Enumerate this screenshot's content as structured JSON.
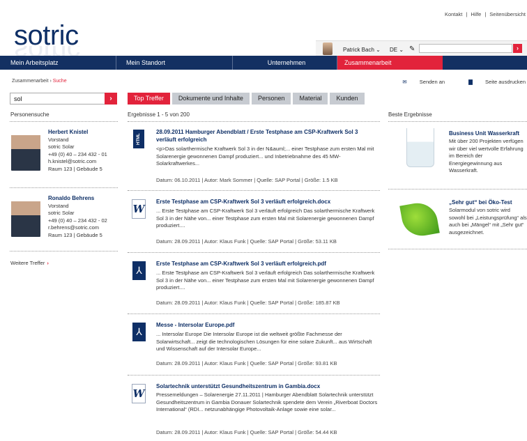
{
  "header": {
    "logo": "sotric",
    "top_links": [
      "Kontakt",
      "Hilfe",
      "Seitenübersicht"
    ],
    "user_name": "Patrick Bach ⌄",
    "language": "DE ⌄",
    "search_placeholder": ""
  },
  "nav": [
    "Mein Arbeitsplatz",
    "Mein Standort",
    "Unternehmen",
    "Zusammenarbeit"
  ],
  "breadcrumb": {
    "prefix": "Zusammenarbeit › ",
    "current": "Suche"
  },
  "actions": {
    "send": "Senden an",
    "print": "Seite ausdrucken"
  },
  "search": {
    "value": "sol"
  },
  "tabs": [
    "Top Treffer",
    "Dokumente und Inhalte",
    "Personen",
    "Material",
    "Kunden"
  ],
  "people": {
    "heading": "Personensuche",
    "list": [
      {
        "name": "Herbert Knistel",
        "role": "Vorstand",
        "company": "sotric Solar",
        "phone": "+49 (0) 40 – 234 432 - 01",
        "email": "h.knistel@sotric.com",
        "room": "Raum 123  |  Gebäude 5"
      },
      {
        "name": "Ronaldo Behrens",
        "role": "Vorstand",
        "company": "sotric Solar",
        "phone": "+49 (0) 40 – 234 432 - 02",
        "email": "r.behrens@sotric.com",
        "room": "Raum 123  |  Gebäude 5"
      }
    ],
    "more": "Weitere Treffer"
  },
  "results": {
    "heading": "Ergebnisse 1 - 5 von 200",
    "list": [
      {
        "icon": "html-file-icon",
        "title": "28.09.2011 Hamburger Abendblatt / Erste Testphase am CSP-Kraftwerk Sol 3 verläuft erfolgreich",
        "snippet": "<p>Das solarthermische Kraftwerk Sol 3 in der N&auml;... einer Testphase zum ersten Mal mit Solarenergie gewonnenen Dampf produziert... und Inbetriebnahme des 45 MW-Solarkraftwerkes...",
        "meta": "Datum: 06.10.2011  |  Autor: Mark Sommer  |  Quelle: SAP Portal  |  Größe: 1.5 KB"
      },
      {
        "icon": "word-doc-icon",
        "title": "Erste Testphase am CSP-Kraftwerk Sol 3 verläuft erfolgreich.docx",
        "snippet": "... Erste Testphase am CSP-Kraftwerk Sol 3 verläuft erfolgreich Das solarthermische Kraftwerk Sol 3 in der Nähe von... einer Testphase zum ersten Mal mit Solarenergie gewonnenen Dampf produziert....",
        "meta": "Datum: 28.09.2011  |  Autor: Klaus Funk  |  Quelle: SAP Portal  |  Größe: 53.11 KB"
      },
      {
        "icon": "pdf-file-icon",
        "title": "Erste Testphase am CSP-Kraftwerk Sol 3 verläuft erfolgreich.pdf",
        "snippet": "... Erste Testphase am CSP-Kraftwerk Sol 3 verläuft erfolgreich Das solarthermische Kraftwerk Sol 3 in der Nähe von... einer Testphase zum ersten Mal mit Solarenergie gewonnenen Dampf produziert....",
        "meta": "Datum: 28.09.2011  |  Autor: Klaus Funk  |  Quelle: SAP Portal  |  Größe: 185.87 KB"
      },
      {
        "icon": "pdf-file-icon",
        "title": "Messe - Intersolar Europe.pdf",
        "snippet": "... Intersolar Europe Die Intersolar Europe ist die weltweit größte Fachmesse der Solarwirtschaft... zeigt die technologischen Lösungen für eine solare Zukunft... aus Wirtschaft und Wissenschaft auf der Intersolar Europe...",
        "meta": "Datum: 28.09.2011  |  Autor: Klaus Funk  |  Quelle: SAP Portal  |  Größe: 93.81 KB"
      },
      {
        "icon": "word-doc-icon",
        "title": "Solartechnik unterstützt Gesundheitszentrum in Gambia.docx",
        "snippet": "Pressemeldungen – Solarenergie 27.11.2011 | Hamburger Abendblatt Solartechnik unterstützt Gesundheitszentrum in Gambia Donauer Solartechnik spendete dem Verein „Riverboat Doctors International“ (RDI... netzunabhängige Photovoltaik-Anlage sowie eine solar...",
        "meta": "Datum: 28.09.2011  |  Autor: Klaus Funk  |  Quelle: SAP Portal  |  Größe: 54.44 KB"
      }
    ]
  },
  "best": {
    "heading": "Beste Ergebnisse",
    "list": [
      {
        "title": "Business Unit Wasserkraft",
        "text": "Mit über 200 Projekten verfügen wir über viel wertvolle Erfahrung im Bereich der Energiegewinnung aus Wasserkraft."
      },
      {
        "title": "„Sehr gut“ bei Öko-Test",
        "text": "Solarmodul von sotric wird sowohl bei „Leistungsprüfung“ als auch bei „Mängel“ mit „Sehr gut“ ausgezeichnet."
      }
    ]
  },
  "colors": {
    "brand_blue": "#0e2f66",
    "accent_red": "#e2233b"
  }
}
